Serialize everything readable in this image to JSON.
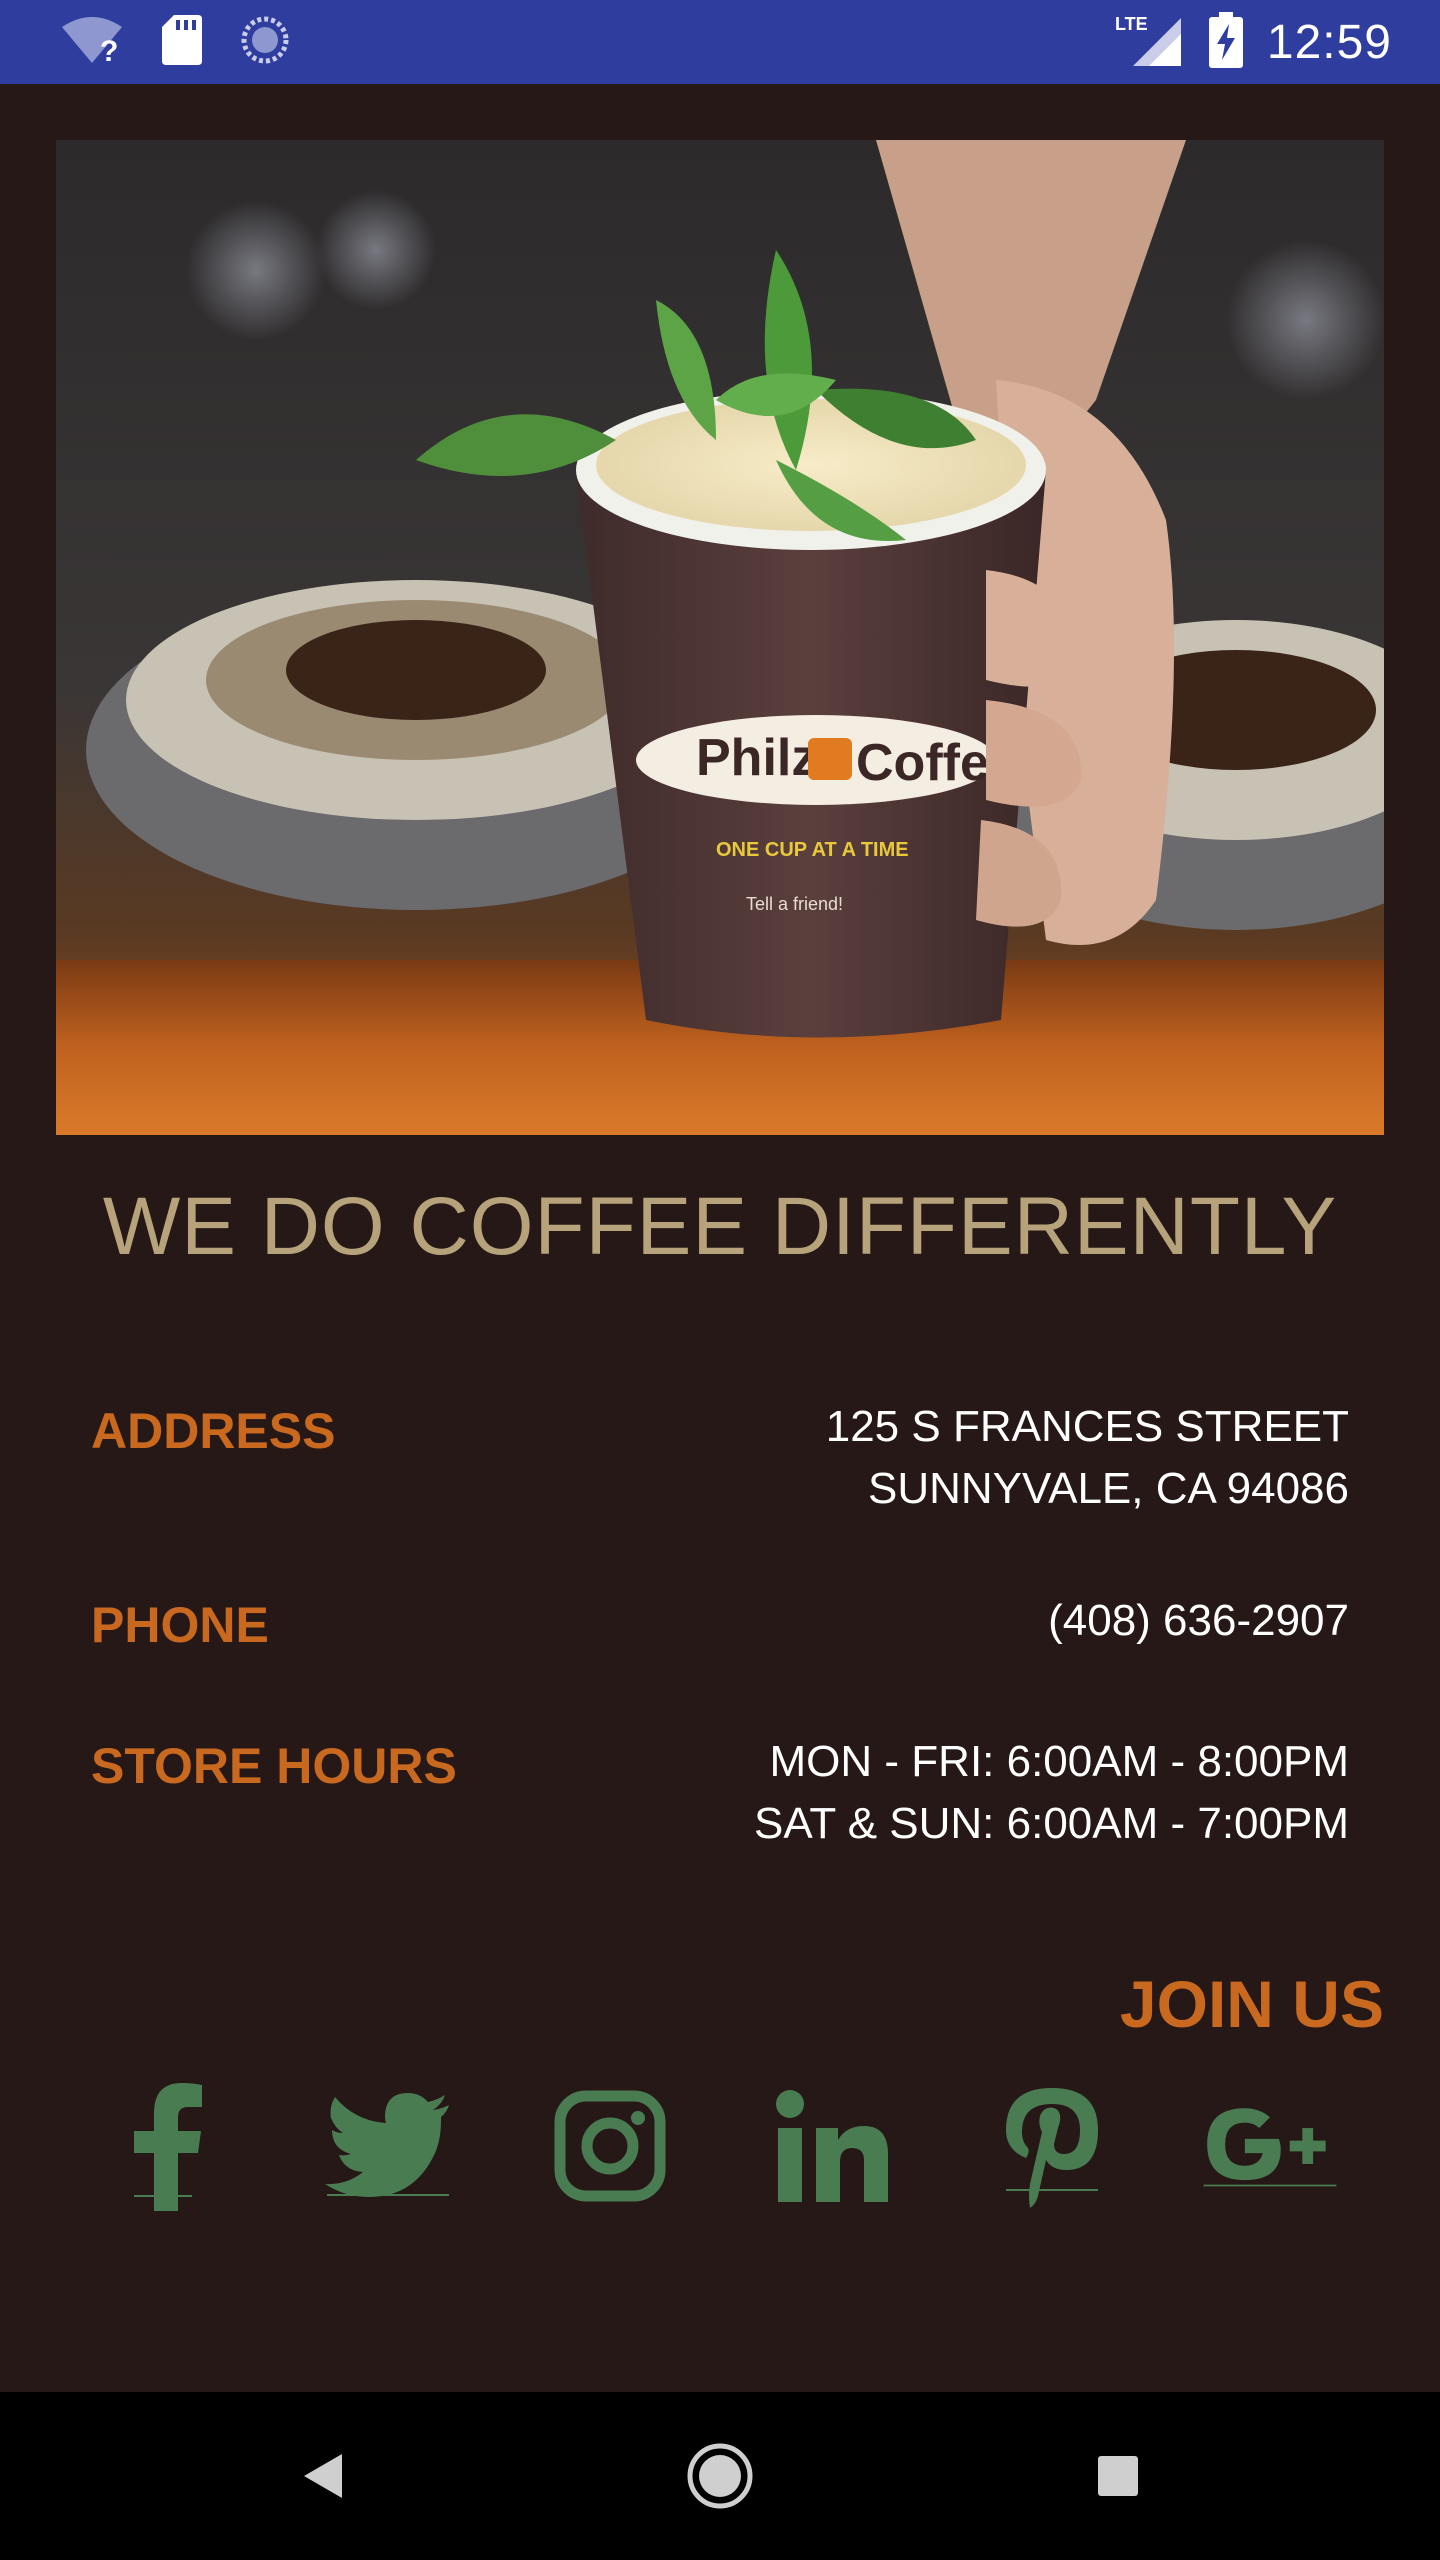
{
  "status_bar": {
    "time": "12:59",
    "network": "LTE",
    "icons": [
      "wifi-question-icon",
      "sd-card-icon",
      "sync-circle-icon",
      "lte-signal-icon",
      "battery-charging-icon"
    ]
  },
  "hero": {
    "cup_brand": "Philz Coffee",
    "cup_slogan": "ONE CUP AT A TIME",
    "cup_note": "Tell a friend!"
  },
  "tagline": "WE DO COFFEE DIFFERENTLY",
  "info": {
    "address": {
      "label": "ADDRESS",
      "line1": "125 S FRANCES STREET",
      "line2": "SUNNYVALE, CA 94086"
    },
    "phone": {
      "label": "PHONE",
      "value": "(408) 636-2907"
    },
    "hours": {
      "label": "STORE HOURS",
      "line1": "MON - FRI: 6:00AM - 8:00PM",
      "line2": "SAT & SUN: 6:00AM - 7:00PM"
    }
  },
  "join_us": "JOIN US",
  "social": [
    "facebook-icon",
    "twitter-icon",
    "instagram-icon",
    "linkedin-icon",
    "pinterest-icon",
    "google-plus-icon"
  ],
  "colors": {
    "background": "#261816",
    "status_bar": "#2f3d9f",
    "accent_orange": "#c8691f",
    "tagline_gold": "#b7a37b",
    "social_green": "#4a7c52",
    "nav_bar": "#000000"
  },
  "nav": [
    "back-icon",
    "home-icon",
    "recents-icon"
  ]
}
